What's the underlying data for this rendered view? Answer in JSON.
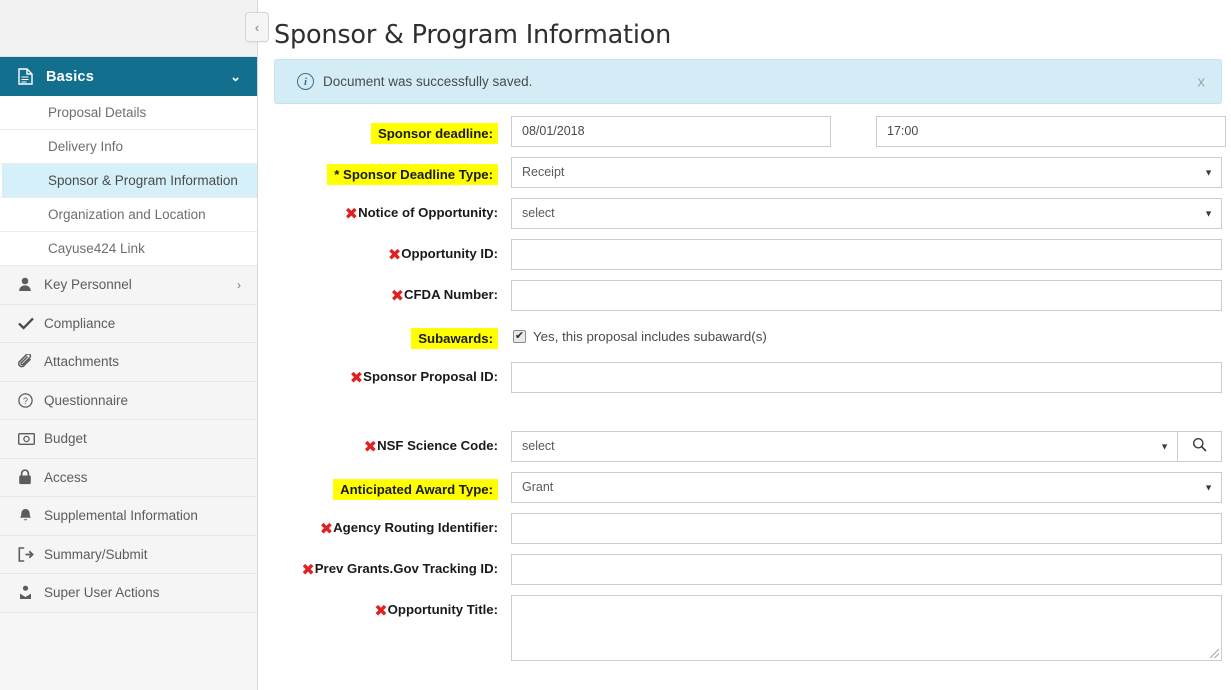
{
  "sidebar": {
    "collapse_label": "‹",
    "section": {
      "label": "Basics",
      "icon": "document-icon",
      "caret": "⌄"
    },
    "subitems": [
      {
        "label": "Proposal Details",
        "active": false
      },
      {
        "label": "Delivery Info",
        "active": false
      },
      {
        "label": "Sponsor & Program Information",
        "active": true
      },
      {
        "label": "Organization and Location",
        "active": false
      },
      {
        "label": "Cayuse424 Link",
        "active": false
      }
    ],
    "items": [
      {
        "label": "Key Personnel",
        "icon": "person-icon",
        "caret": "›"
      },
      {
        "label": "Compliance",
        "icon": "check-icon",
        "caret": ""
      },
      {
        "label": "Attachments",
        "icon": "paperclip-icon",
        "caret": ""
      },
      {
        "label": "Questionnaire",
        "icon": "question-circle-icon",
        "caret": ""
      },
      {
        "label": "Budget",
        "icon": "money-icon",
        "caret": ""
      },
      {
        "label": "Access",
        "icon": "lock-icon",
        "caret": ""
      },
      {
        "label": "Supplemental Information",
        "icon": "bell-icon",
        "caret": ""
      },
      {
        "label": "Summary/Submit",
        "icon": "submit-arrow-icon",
        "caret": ""
      },
      {
        "label": "Super User Actions",
        "icon": "super-user-icon",
        "caret": ""
      }
    ]
  },
  "header": {
    "title": "Sponsor & Program Information"
  },
  "alert": {
    "icon": "info-icon",
    "message": "Document was successfully saved.",
    "close_label": "x"
  },
  "form": {
    "rows": {
      "sponsor_deadline": {
        "label": "Sponsor deadline:",
        "value": "08/01/2018",
        "time_value": "17:00"
      },
      "sponsor_deadline_type": {
        "label": "* Sponsor Deadline Type:",
        "value": "Receipt"
      },
      "notice_of_opportunity": {
        "label": "Notice of Opportunity:",
        "value": "select"
      },
      "opportunity_id": {
        "label": "Opportunity ID:",
        "value": ""
      },
      "cfda_number": {
        "label": "CFDA Number:",
        "value": ""
      },
      "subawards": {
        "label": "Subawards:",
        "checkbox_label": "Yes, this proposal includes subaward(s)",
        "checked": true,
        "check_glyph": "✔"
      },
      "sponsor_proposal_id": {
        "label": "Sponsor Proposal ID:",
        "value": ""
      },
      "nsf_science_code": {
        "label": "NSF Science Code:",
        "value": "select",
        "search_icon": "magnifier-icon"
      },
      "anticipated_award_type": {
        "label": "Anticipated Award Type:",
        "value": "Grant"
      },
      "agency_routing_identifier": {
        "label": "Agency Routing Identifier:",
        "value": ""
      },
      "prev_grants_gov_tracking_id": {
        "label": "Prev Grants.Gov Tracking ID:",
        "value": ""
      },
      "opportunity_title": {
        "label": "Opportunity Title:",
        "value": ""
      }
    },
    "xmark": "✖",
    "caret": "▼"
  },
  "colors": {
    "sidebar_active_section": "#126F8E",
    "sidebar_active_item": "#d6f0f9",
    "alert_bg": "#d3ecf5",
    "highlight": "#ffff00",
    "error_mark": "#e02121"
  }
}
